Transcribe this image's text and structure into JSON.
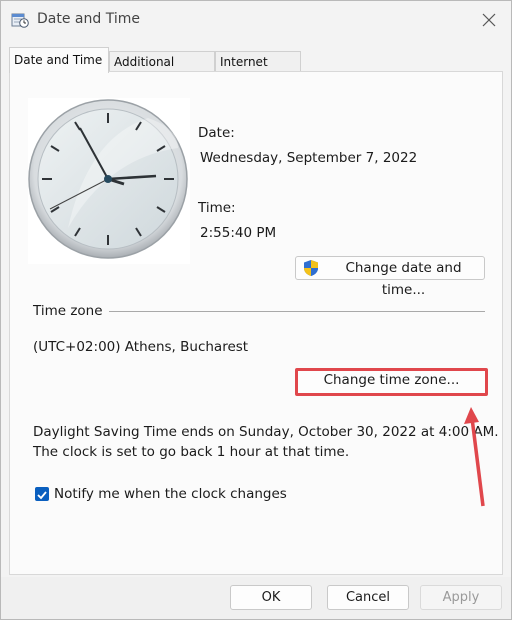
{
  "window": {
    "title": "Date and Time"
  },
  "tabs": [
    {
      "label": "Date and Time"
    },
    {
      "label": "Additional Clocks"
    },
    {
      "label": "Internet Time"
    }
  ],
  "datetime": {
    "date_label": "Date:",
    "date_value": "Wednesday, September 7, 2022",
    "time_label": "Time:",
    "time_value": "2:55:40 PM",
    "change_button": "Change date and time..."
  },
  "timezone": {
    "heading": "Time zone",
    "value": "(UTC+02:00) Athens, Bucharest",
    "change_button": "Change time zone...",
    "dst_line1": "Daylight Saving Time ends on Sunday, October 30, 2022 at 4:00 AM.",
    "dst_line2": "The clock is set to go back 1 hour at that time.",
    "notify_label": "Notify me when the clock changes",
    "notify_checked": true
  },
  "footer": {
    "ok": "OK",
    "cancel": "Cancel",
    "apply": "Apply"
  },
  "colors": {
    "accent": "#0a5fbf",
    "highlight": "#e0474c"
  },
  "icons": {
    "title": "calendar-clock-icon",
    "close": "close-icon",
    "shield": "uac-shield-icon",
    "check": "checkmark-icon",
    "arrow": "annotation-arrow"
  }
}
